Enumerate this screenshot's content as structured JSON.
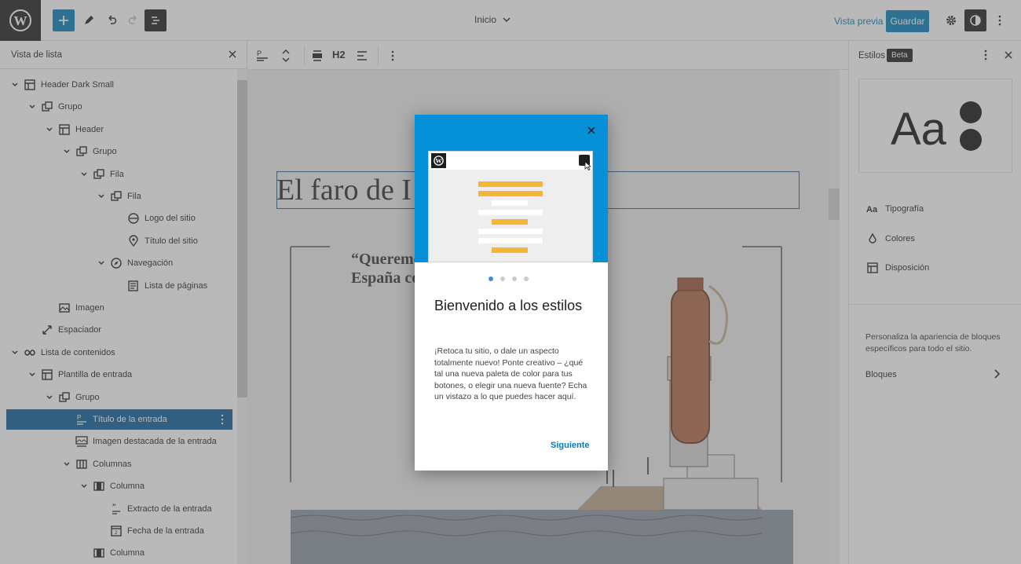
{
  "topbar": {
    "doc_title": "Inicio",
    "preview": "Vista previa",
    "save": "Guardar"
  },
  "list_view": {
    "title": "Vista de lista",
    "items": [
      {
        "label": "Header Dark Small",
        "level": 0,
        "icon": "layout-icon",
        "expanded": true
      },
      {
        "label": "Grupo",
        "level": 1,
        "icon": "group-icon",
        "expanded": true
      },
      {
        "label": "Header",
        "level": 2,
        "icon": "layout-icon",
        "expanded": true
      },
      {
        "label": "Grupo",
        "level": 3,
        "icon": "group-icon",
        "expanded": true
      },
      {
        "label": "Fila",
        "level": 4,
        "icon": "group-icon",
        "expanded": true
      },
      {
        "label": "Fila",
        "level": 5,
        "icon": "group-icon",
        "expanded": true
      },
      {
        "label": "Logo del sitio",
        "level": 6,
        "icon": "site-logo-icon",
        "expanded": null
      },
      {
        "label": "Título del sitio",
        "level": 6,
        "icon": "map-marker-icon",
        "expanded": null
      },
      {
        "label": "Navegación",
        "level": 5,
        "icon": "navigation-icon",
        "expanded": true
      },
      {
        "label": "Lista de páginas",
        "level": 6,
        "icon": "page-list-icon",
        "expanded": null
      },
      {
        "label": "Imagen",
        "level": 2,
        "icon": "image-icon",
        "expanded": null
      },
      {
        "label": "Espaciador",
        "level": 1,
        "icon": "resize-icon",
        "expanded": null
      },
      {
        "label": "Lista de contenidos",
        "level": 0,
        "icon": "loop-icon",
        "expanded": true
      },
      {
        "label": "Plantilla de entrada",
        "level": 1,
        "icon": "layout-icon",
        "expanded": true
      },
      {
        "label": "Grupo",
        "level": 2,
        "icon": "group-icon",
        "expanded": true
      },
      {
        "label": "Título de la entrada",
        "level": 3,
        "icon": "post-title-icon",
        "expanded": null,
        "selected": true
      },
      {
        "label": "Imagen destacada de la entrada",
        "level": 3,
        "icon": "featured-image-icon",
        "expanded": null
      },
      {
        "label": "Columnas",
        "level": 3,
        "icon": "columns-icon",
        "expanded": true
      },
      {
        "label": "Columna",
        "level": 4,
        "icon": "column-icon",
        "expanded": true
      },
      {
        "label": "Extracto de la entrada",
        "level": 5,
        "icon": "excerpt-icon",
        "expanded": null
      },
      {
        "label": "Fecha de la entrada",
        "level": 5,
        "icon": "date-icon",
        "expanded": null
      },
      {
        "label": "Columna",
        "level": 4,
        "icon": "column-icon",
        "expanded": null
      }
    ]
  },
  "toolbar": {
    "heading_level": "H2"
  },
  "canvas": {
    "heading": "El faro de I",
    "quote": "“Queremo\nEspaña co"
  },
  "styles_panel": {
    "title": "Estilos",
    "badge": "Beta",
    "preview_text": "Aa",
    "items": [
      {
        "label": "Tipografía",
        "icon": "typography-icon"
      },
      {
        "label": "Colores",
        "icon": "droplet-icon"
      },
      {
        "label": "Disposición",
        "icon": "layout-icon"
      }
    ],
    "description": "Personaliza la apariencia de bloques específicos para todo el sitio.",
    "blocks": "Bloques"
  },
  "modal": {
    "title": "Bienvenido a los estilos",
    "body": "¡Retoca tu sitio, o dale un aspecto totalmente nuevo! Ponte creativo – ¿qué tal una nueva paleta de color para tus botones, o elegir una nueva fuente? Echa un vistazo a lo que puedes hacer aquí.",
    "next": "Siguiente",
    "page_index": 1,
    "page_count": 4
  },
  "colors": {
    "accent": "#007cba",
    "selected_row": "#0a5c95",
    "modal_hero": "#0590d8",
    "mini_bar": "#f5b638"
  }
}
